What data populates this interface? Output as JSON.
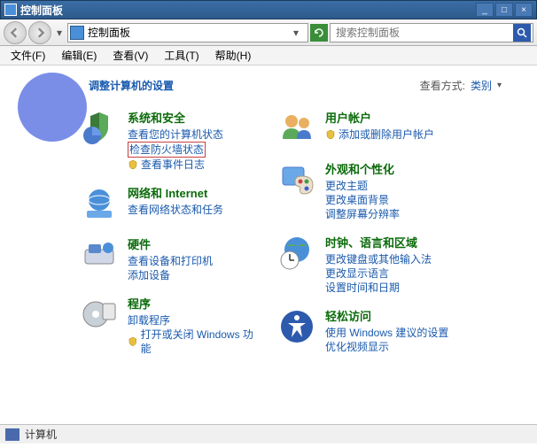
{
  "window": {
    "title": "控制面板"
  },
  "win_controls": {
    "min": "_",
    "max": "□",
    "close": "×"
  },
  "address": {
    "text": "控制面板",
    "dropdown": "▾",
    "refresh": "↻"
  },
  "search": {
    "placeholder": "搜索控制面板"
  },
  "menus": {
    "file": "文件(F)",
    "edit": "编辑(E)",
    "view": "查看(V)",
    "tools": "工具(T)",
    "help": "帮助(H)"
  },
  "header": {
    "title": "调整计算机的设置"
  },
  "viewmode": {
    "label": "查看方式:",
    "value": "类别",
    "arrow": "▾"
  },
  "cats": {
    "sys": {
      "title": "系统和安全",
      "l1": "查看您的计算机状态",
      "l2": "检查防火墙状态",
      "l3": "查看事件日志"
    },
    "net": {
      "title": "网络和 Internet",
      "l1": "查看网络状态和任务"
    },
    "hw": {
      "title": "硬件",
      "l1": "查看设备和打印机",
      "l2": "添加设备"
    },
    "prog": {
      "title": "程序",
      "l1": "卸载程序",
      "l2": "打开或关闭 Windows 功能"
    },
    "user": {
      "title": "用户帐户",
      "l1": "添加或删除用户帐户"
    },
    "appn": {
      "title": "外观和个性化",
      "l1": "更改主题",
      "l2": "更改桌面背景",
      "l3": "调整屏幕分辨率"
    },
    "clk": {
      "title": "时钟、语言和区域",
      "l1": "更改键盘或其他输入法",
      "l2": "更改显示语言",
      "l3": "设置时间和日期"
    },
    "ease": {
      "title": "轻松访问",
      "l1": "使用 Windows 建议的设置",
      "l2": "优化视频显示"
    }
  },
  "status": {
    "text": "计算机"
  }
}
